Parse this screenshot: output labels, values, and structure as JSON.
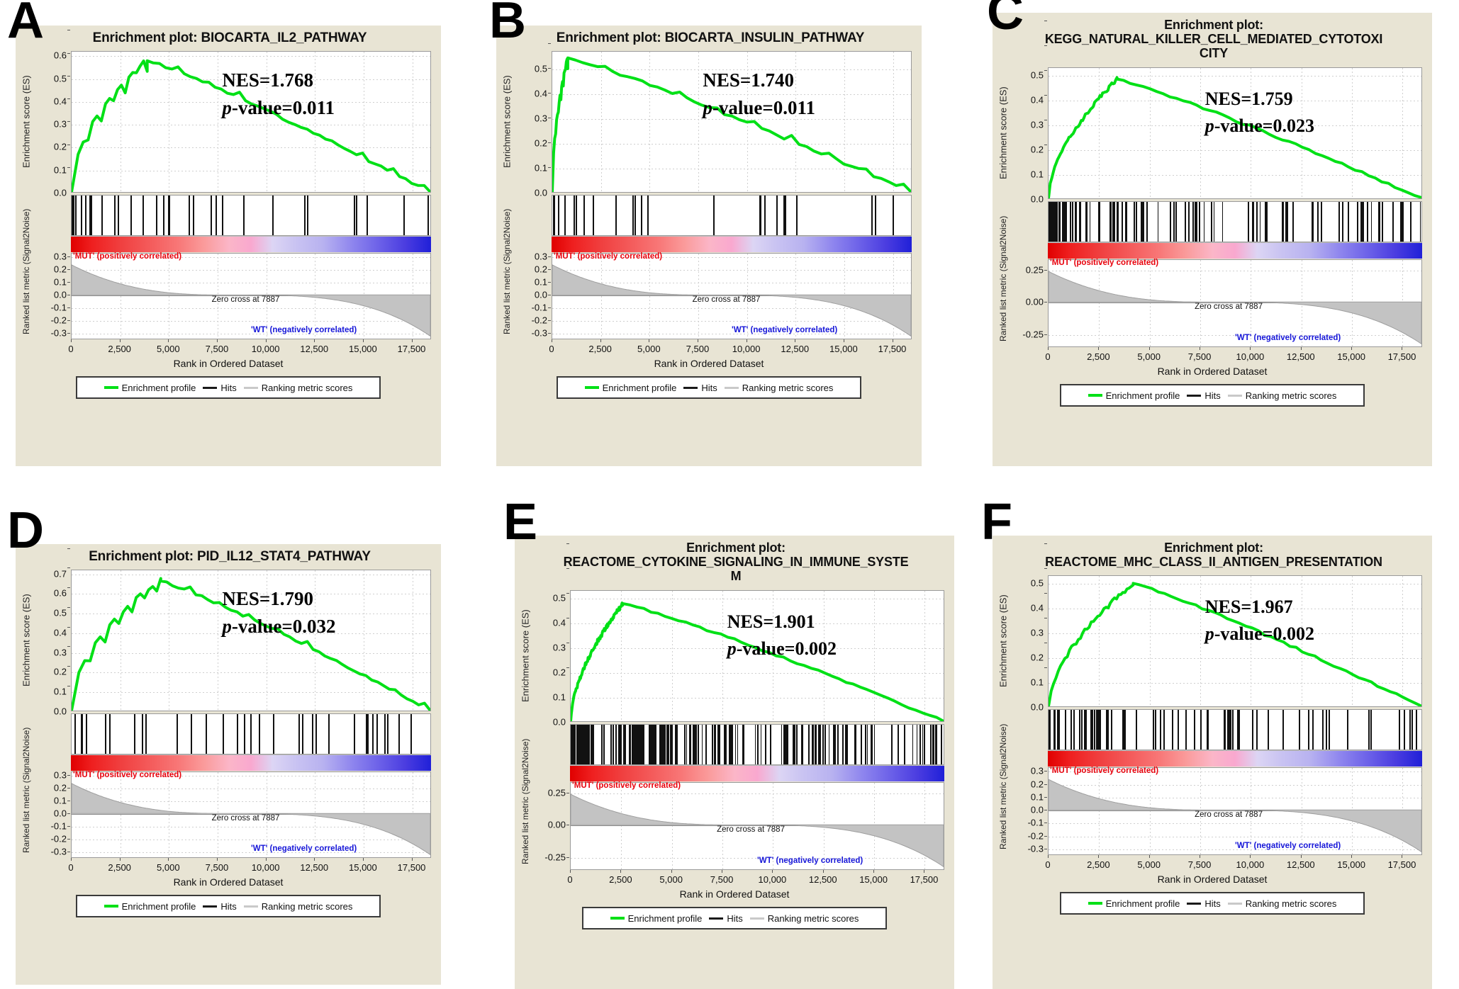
{
  "figure": {
    "panel_letters": [
      "A",
      "B",
      "C",
      "D",
      "E",
      "F"
    ],
    "common": {
      "title_prefix": "Enrichment plot:",
      "y_axis_label_top": "Enrichment score (ES)",
      "y_axis_label_bottom": "Ranked list metric (Signal2Noise)",
      "x_axis_label": "Rank in Ordered Dataset",
      "x_ticks": [
        "0",
        "2,500",
        "5,000",
        "7,500",
        "10,000",
        "12,500",
        "15,000",
        "17,500"
      ],
      "x_tick_values": [
        0,
        2500,
        5000,
        7500,
        10000,
        12500,
        15000,
        17500
      ],
      "x_range": [
        0,
        18500
      ],
      "positive_corr_label": "'MUT' (positively correlated)",
      "negative_corr_label": "'WT' (negatively correlated)",
      "zero_cross_label": "Zero cross at 7887",
      "zero_cross_rank": 7887,
      "legend": [
        {
          "name": "enrichment-profile",
          "label": "Enrichment profile",
          "swatch": "green"
        },
        {
          "name": "hits",
          "label": "Hits",
          "swatch": "black"
        },
        {
          "name": "ranking-metric-scores",
          "label": "Ranking metric scores",
          "swatch": "grey"
        }
      ],
      "colors": {
        "panel_background": "#e8e4d4",
        "enrichment_curve": "#00e016",
        "hits_marks": "#111111",
        "ranking_fill": "#c3c3c3",
        "positive_corr_text": "#e8000b",
        "negative_corr_text": "#1616d8",
        "heatmap_high": "#e00000",
        "heatmap_low": "#2020d8"
      }
    },
    "panels": [
      {
        "letter": "A",
        "title_lines": [
          "Enrichment plot: BIOCARTA_IL2_PATHWAY"
        ],
        "nes_label": "NES=1.768",
        "nes": 1.768,
        "pvalue_label": "p-value=0.011",
        "pvalue": 0.011,
        "es_ticks": [
          "0.6",
          "0.5",
          "0.4",
          "0.3",
          "0.2",
          "0.1",
          "0.0"
        ],
        "es_tick_values": [
          0.6,
          0.5,
          0.4,
          0.3,
          0.2,
          0.1,
          0.0
        ],
        "es_range": [
          0.0,
          0.62
        ],
        "rank_ticks": [
          "0.3",
          "0.2",
          "0.1",
          "0.0",
          "-0.1",
          "-0.2",
          "-0.3"
        ],
        "rank_tick_values": [
          0.3,
          0.2,
          0.1,
          0.0,
          -0.1,
          -0.2,
          -0.3
        ],
        "rank_range": [
          -0.35,
          0.33
        ],
        "peak_es": 0.58,
        "peak_rank": 3900,
        "n_hits": 32
      },
      {
        "letter": "B",
        "title_lines": [
          "Enrichment plot: BIOCARTA_INSULIN_PATHWAY"
        ],
        "nes_label": "NES=1.740",
        "nes": 1.74,
        "pvalue_label": "p-value=0.011",
        "pvalue": 0.011,
        "es_ticks": [
          "0.5",
          "0.4",
          "0.3",
          "0.2",
          "0.1",
          "0.0"
        ],
        "es_tick_values": [
          0.5,
          0.4,
          0.3,
          0.2,
          0.1,
          0.0
        ],
        "es_range": [
          0.0,
          0.57
        ],
        "rank_ticks": [
          "0.3",
          "0.2",
          "0.1",
          "0.0",
          "-0.1",
          "-0.2",
          "-0.3"
        ],
        "rank_tick_values": [
          0.3,
          0.2,
          0.1,
          0.0,
          -0.1,
          -0.2,
          -0.3
        ],
        "rank_range": [
          -0.35,
          0.33
        ],
        "peak_es": 0.545,
        "peak_rank": 800,
        "n_hits": 26
      },
      {
        "letter": "C",
        "title_lines": [
          "Enrichment plot:",
          "KEGG_NATURAL_KILLER_CELL_MEDIATED_CYTOTOXI",
          "CITY"
        ],
        "nes_label": "NES=1.759",
        "nes": 1.759,
        "pvalue_label": "p-value=0.023",
        "pvalue": 0.023,
        "es_ticks": [
          "0.5",
          "0.4",
          "0.3",
          "0.2",
          "0.1",
          "0.0"
        ],
        "es_tick_values": [
          0.5,
          0.4,
          0.3,
          0.2,
          0.1,
          0.0
        ],
        "es_range": [
          0.0,
          0.53
        ],
        "rank_ticks": [
          "0.25",
          "0.00",
          "-0.25"
        ],
        "rank_tick_values": [
          0.25,
          0.0,
          -0.25
        ],
        "rank_range": [
          -0.35,
          0.33
        ],
        "peak_es": 0.485,
        "peak_rank": 3400,
        "n_hits": 90
      },
      {
        "letter": "D",
        "title_lines": [
          "Enrichment plot: PID_IL12_STAT4_PATHWAY"
        ],
        "nes_label": "NES=1.790",
        "nes": 1.79,
        "pvalue_label": "p-value=0.032",
        "pvalue": 0.032,
        "es_ticks": [
          "0.7",
          "0.6",
          "0.5",
          "0.4",
          "0.3",
          "0.2",
          "0.1",
          "0.0"
        ],
        "es_tick_values": [
          0.7,
          0.6,
          0.5,
          0.4,
          0.3,
          0.2,
          0.1,
          0.0
        ],
        "es_range": [
          0.0,
          0.72
        ],
        "rank_ticks": [
          "0.3",
          "0.2",
          "0.1",
          "0.0",
          "-0.1",
          "-0.2",
          "-0.3"
        ],
        "rank_tick_values": [
          0.3,
          0.2,
          0.1,
          0.0,
          -0.1,
          -0.2,
          -0.3
        ],
        "rank_range": [
          -0.35,
          0.33
        ],
        "peak_es": 0.665,
        "peak_rank": 4600,
        "n_hits": 34
      },
      {
        "letter": "E",
        "title_lines": [
          "Enrichment plot:",
          "REACTOME_CYTOKINE_SIGNALING_IN_IMMUNE_SYSTE",
          "M"
        ],
        "nes_label": "NES=1.901",
        "nes": 1.901,
        "pvalue_label": "p-value=0.002",
        "pvalue": 0.002,
        "es_ticks": [
          "0.5",
          "0.4",
          "0.3",
          "0.2",
          "0.1",
          "0.0"
        ],
        "es_tick_values": [
          0.5,
          0.4,
          0.3,
          0.2,
          0.1,
          0.0
        ],
        "es_range": [
          0.0,
          0.53
        ],
        "rank_ticks": [
          "0.25",
          "0.00",
          "-0.25"
        ],
        "rank_tick_values": [
          0.25,
          0.0,
          -0.25
        ],
        "rank_range": [
          -0.35,
          0.33
        ],
        "peak_es": 0.478,
        "peak_rank": 2600,
        "n_hits": 180
      },
      {
        "letter": "F",
        "title_lines": [
          "Enrichment plot:",
          "REACTOME_MHC_CLASS_II_ANTIGEN_PRESENTATION"
        ],
        "nes_label": "NES=1.967",
        "nes": 1.967,
        "pvalue_label": "p-value=0.002",
        "pvalue": 0.002,
        "es_ticks": [
          "0.5",
          "0.4",
          "0.3",
          "0.2",
          "0.1",
          "0.0"
        ],
        "es_tick_values": [
          0.5,
          0.4,
          0.3,
          0.2,
          0.1,
          0.0
        ],
        "es_range": [
          0.0,
          0.53
        ],
        "rank_ticks": [
          "0.3",
          "0.2",
          "0.1",
          "0.0",
          "-0.1",
          "-0.2",
          "-0.3"
        ],
        "rank_tick_values": [
          0.3,
          0.2,
          0.1,
          0.0,
          -0.1,
          -0.2,
          -0.3
        ],
        "rank_range": [
          -0.35,
          0.33
        ],
        "peak_es": 0.5,
        "peak_rank": 4200,
        "n_hits": 70
      }
    ]
  },
  "chart_data": {
    "type": "line",
    "title": "GSEA enrichment plots for six gene sets",
    "xlabel": "Rank in Ordered Dataset",
    "ylabel": "Enrichment score (ES)",
    "xlim": [
      0,
      18500
    ],
    "grid": true,
    "legend_position": "bottom",
    "series": [
      {
        "name": "BIOCARTA_IL2_PATHWAY",
        "panel": "A",
        "nes": 1.768,
        "pvalue": 0.011,
        "max_es": 0.58,
        "ylim": [
          0.0,
          0.62
        ]
      },
      {
        "name": "BIOCARTA_INSULIN_PATHWAY",
        "panel": "B",
        "nes": 1.74,
        "pvalue": 0.011,
        "max_es": 0.545,
        "ylim": [
          0.0,
          0.57
        ]
      },
      {
        "name": "KEGG_NATURAL_KILLER_CELL_MEDIATED_CYTOTOXICITY",
        "panel": "C",
        "nes": 1.759,
        "pvalue": 0.023,
        "max_es": 0.485,
        "ylim": [
          0.0,
          0.53
        ]
      },
      {
        "name": "PID_IL12_STAT4_PATHWAY",
        "panel": "D",
        "nes": 1.79,
        "pvalue": 0.032,
        "max_es": 0.665,
        "ylim": [
          0.0,
          0.72
        ]
      },
      {
        "name": "REACTOME_CYTOKINE_SIGNALING_IN_IMMUNE_SYSTEM",
        "panel": "E",
        "nes": 1.901,
        "pvalue": 0.002,
        "max_es": 0.478,
        "ylim": [
          0.0,
          0.53
        ]
      },
      {
        "name": "REACTOME_MHC_CLASS_II_ANTIGEN_PRESENTATION",
        "panel": "F",
        "nes": 1.967,
        "pvalue": 0.002,
        "max_es": 0.5,
        "ylim": [
          0.0,
          0.53
        ]
      }
    ],
    "zero_cross_rank": 7887
  }
}
